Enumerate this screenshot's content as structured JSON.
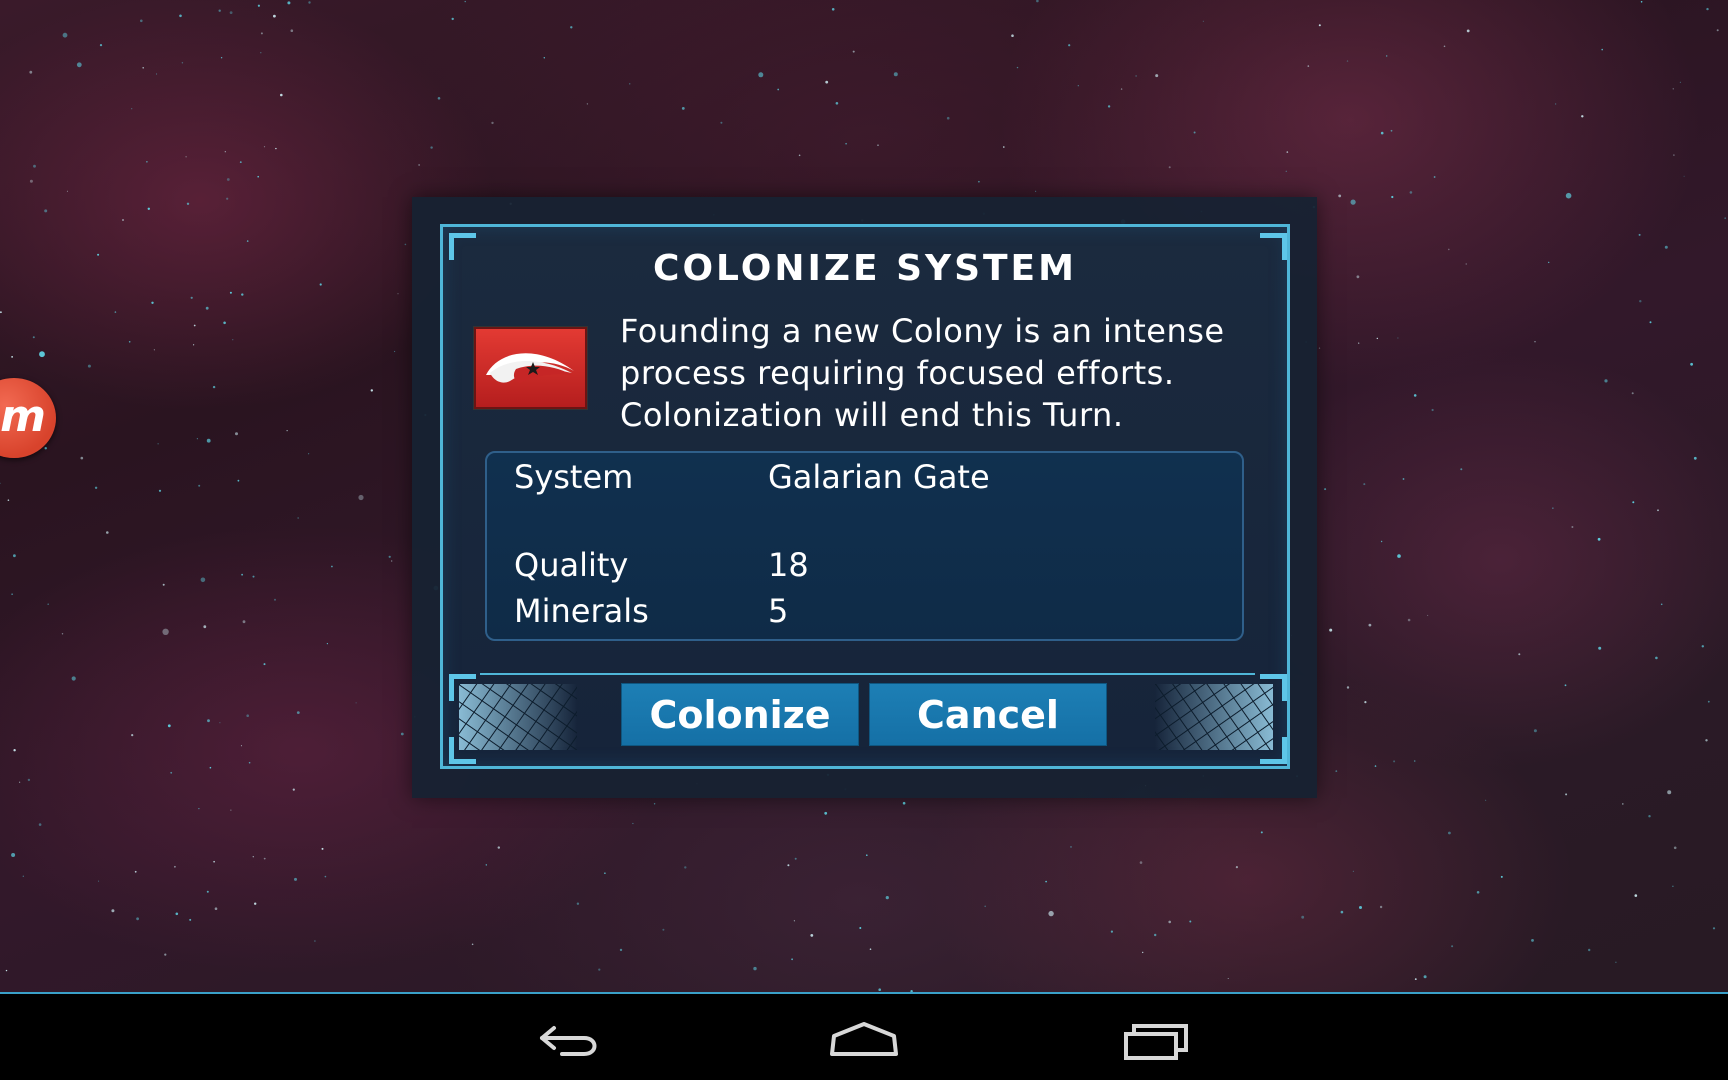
{
  "dialog": {
    "title": "COLONIZE SYSTEM",
    "description_lines": [
      "Founding a new Colony is an intense",
      "process requiring focused efforts.",
      "Colonization will end this Turn."
    ],
    "info": {
      "system_label": "System",
      "system_value": "Galarian Gate",
      "quality_label": "Quality",
      "quality_value": "18",
      "minerals_label": "Minerals",
      "minerals_value": "5"
    },
    "buttons": {
      "colonize_label": "Colonize",
      "cancel_label": "Cancel"
    },
    "flag_icon": "faction-flag-icon"
  },
  "side_badge": {
    "letter": "m"
  },
  "nav_icons": [
    "back-icon",
    "home-icon",
    "recents-icon"
  ],
  "colors": {
    "frame_accent": "#4fb6d8",
    "button": "#1570a6",
    "flag_red": "#d42b2b",
    "badge": "#e2553e"
  }
}
